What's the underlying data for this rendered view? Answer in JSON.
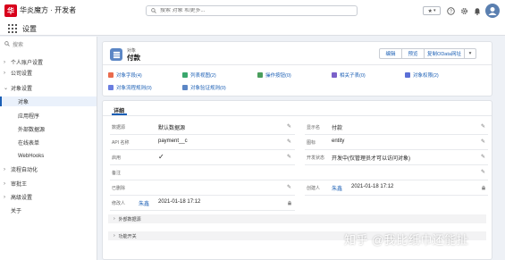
{
  "app": {
    "brand": "华炎魔方 · 开发者",
    "logo_letter": "华",
    "nav_title": "设置"
  },
  "search": {
    "placeholder": "搜索 对象 和更多..."
  },
  "topbar": {
    "favorite_star": "★"
  },
  "sidebar": {
    "search_placeholder": "搜索",
    "items": [
      {
        "label": "个人账户设置",
        "kind": "top",
        "caret": "›"
      },
      {
        "label": "公司设置",
        "kind": "top",
        "caret": "›"
      },
      {
        "label": "对象设置",
        "kind": "top",
        "caret": "⌄"
      },
      {
        "label": "对象",
        "kind": "sub",
        "selected": true
      },
      {
        "label": "应用程序",
        "kind": "sub"
      },
      {
        "label": "外部数据源",
        "kind": "sub"
      },
      {
        "label": "在线表单",
        "kind": "sub"
      },
      {
        "label": "WebHooks",
        "kind": "sub"
      },
      {
        "label": "流程自动化",
        "kind": "top",
        "caret": "›"
      },
      {
        "label": "审批王",
        "kind": "top",
        "caret": "›"
      },
      {
        "label": "高级设置",
        "kind": "top",
        "caret": "›"
      },
      {
        "label": "关于",
        "kind": "top",
        "caret": ""
      }
    ]
  },
  "header": {
    "type_label": "对象",
    "name": "付款",
    "buttons": [
      "编辑",
      "预览",
      "复制OData网址",
      "▾"
    ],
    "related": [
      {
        "label": "对象字段(4)",
        "color": "#e96b4d"
      },
      {
        "label": "列表视图(2)",
        "color": "#3aa76d"
      },
      {
        "label": "操作按钮(0)",
        "color": "#4a9e5c"
      },
      {
        "label": "相关子表(0)",
        "color": "#7b61c9"
      },
      {
        "label": "对象权限(2)",
        "color": "#5b6fd6"
      },
      {
        "label": "对象流程规则(0)",
        "color": "#6a7ee0"
      },
      {
        "label": "对象验证规则(0)",
        "color": "#5b86c5"
      }
    ]
  },
  "detail": {
    "tab": "详细",
    "fields": {
      "datasource_label": "数据源",
      "datasource_value": "默认数据源",
      "display_label": "显示名",
      "display_value": "付款",
      "api_label": "API 名称",
      "api_value": "payment__c",
      "icon_label": "图标",
      "icon_value": "entity",
      "enabled_label": "启用",
      "enabled_value": "✓",
      "devstatus_label": "开发状态",
      "devstatus_value": "开发中(仅管理员才可以访问对象)",
      "remark_label": "备注",
      "deleted_label": "已删除",
      "creator_label": "创建人",
      "creator_name": "朱鑫",
      "creator_time": "2021-01-18 17:12",
      "modifier_label": "修改人",
      "modifier_name": "朱鑫",
      "modifier_time": "2021-01-18 17:12"
    },
    "sections": [
      "外部数据源",
      "功能开关"
    ]
  },
  "watermark": "知乎 @我比纸巾还能扯",
  "colors": {
    "accent": "#1b5fb5",
    "logo": "#d8001b",
    "object_icon": "#5b86c5"
  }
}
